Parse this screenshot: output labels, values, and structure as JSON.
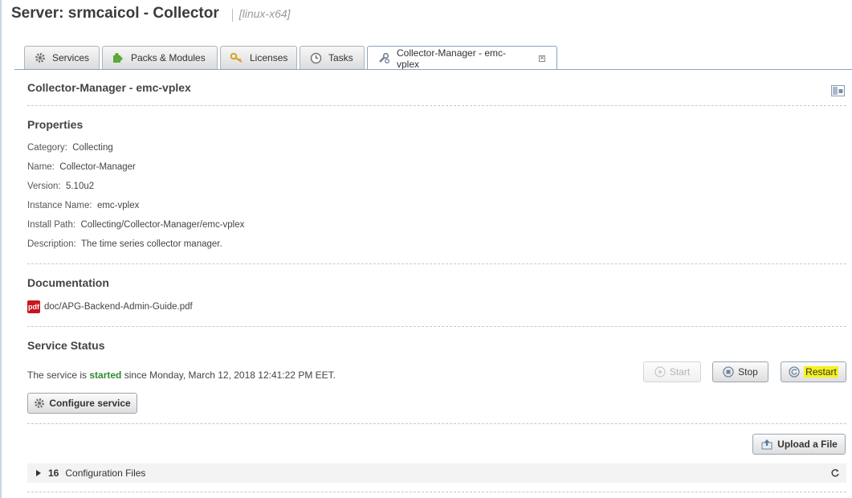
{
  "header": {
    "title": "Server: srmcaicol - Collector",
    "platform": "[linux-x64]"
  },
  "tabs": [
    {
      "label": "Services",
      "icon": "gear-icon"
    },
    {
      "label": "Packs & Modules",
      "icon": "puzzle-icon"
    },
    {
      "label": "Licenses",
      "icon": "key-icon"
    },
    {
      "label": "Tasks",
      "icon": "clock-icon"
    },
    {
      "label": "Collector-Manager - emc-vplex",
      "icon": "wrench-icon",
      "active": true
    }
  ],
  "panel": {
    "title": "Collector-Manager - emc-vplex"
  },
  "properties": {
    "heading": "Properties",
    "items": [
      {
        "key": "Category:",
        "value": "Collecting"
      },
      {
        "key": "Name:",
        "value": "Collector-Manager"
      },
      {
        "key": "Version:",
        "value": "5.10u2"
      },
      {
        "key": "Instance Name:",
        "value": "emc-vplex"
      },
      {
        "key": "Install Path:",
        "value": "Collecting/Collector-Manager/emc-vplex"
      },
      {
        "key": "Description:",
        "value": "The time series collector manager."
      }
    ]
  },
  "documentation": {
    "heading": "Documentation",
    "pdf_badge": "pdf",
    "link": "doc/APG-Backend-Admin-Guide.pdf"
  },
  "service_status": {
    "heading": "Service Status",
    "prefix": "The service is",
    "state": "started",
    "since": "since Monday, March 12, 2018 12:41:22 PM EET.",
    "start_label": "Start",
    "stop_label": "Stop",
    "restart_label": "Restart",
    "configure_label": "Configure service"
  },
  "files": {
    "upload_label": "Upload a File",
    "count": "16",
    "label": "Configuration Files"
  },
  "colors": {
    "started": "#2e8b2e",
    "highlight": "#f6f21d",
    "active_border": "#8da3bd"
  }
}
